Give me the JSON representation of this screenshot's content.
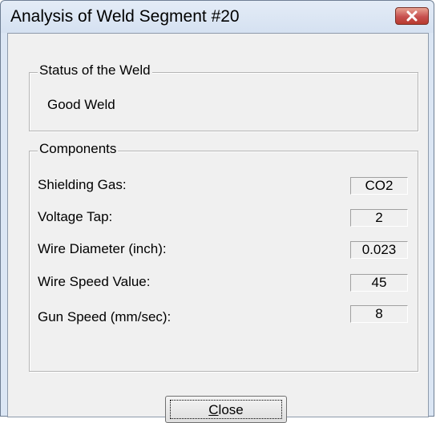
{
  "window": {
    "title": "Analysis of Weld Segment #20",
    "close_icon": "close-x-icon"
  },
  "status_group": {
    "legend": "Status of the Weld",
    "value": "Good Weld"
  },
  "components_group": {
    "legend": "Components",
    "rows": [
      {
        "label": "Shielding Gas:",
        "value": "CO2"
      },
      {
        "label": "Voltage Tap:",
        "value": "2"
      },
      {
        "label": "Wire Diameter (inch):",
        "value": "0.023"
      },
      {
        "label": "Wire Speed Value:",
        "value": "45"
      },
      {
        "label": "Gun Speed (mm/sec):",
        "value": "8"
      }
    ]
  },
  "buttons": {
    "close_mnemonic": "C",
    "close_rest": "lose"
  },
  "colors": {
    "title_bar": "#d5e1f1",
    "client_bg": "#f0f0f0",
    "close_x_red": "#c75050"
  }
}
